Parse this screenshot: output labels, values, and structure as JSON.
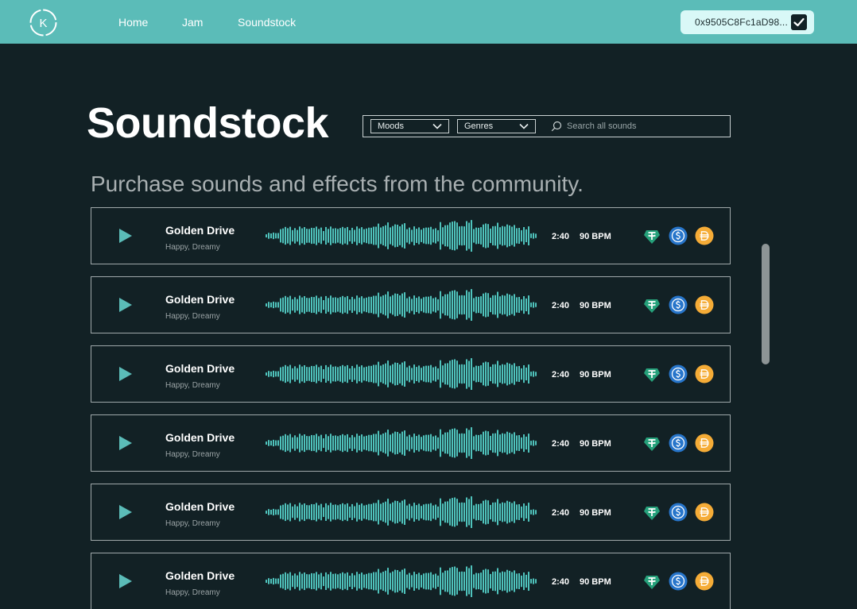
{
  "nav": {
    "logo_letter": "K",
    "links": [
      "Home",
      "Jam",
      "Soundstock"
    ],
    "wallet_address": "0x9505C8Fc1aD98..."
  },
  "header": {
    "title": "Soundstock",
    "filters": [
      {
        "label": "Moods"
      },
      {
        "label": "Genres"
      }
    ],
    "search_placeholder": "Search all sounds",
    "subtitle": "Purchase sounds and effects from the community."
  },
  "colors": {
    "accent": "#5bbcb8",
    "background": "#122125",
    "waveform": "#4fc3bc",
    "usdt": "#26a17b",
    "usdc": "#2775ca",
    "dai": "#f5ac37"
  },
  "tracks": [
    {
      "title": "Golden Drive",
      "tags": "Happy, Dreamy",
      "duration": "2:40",
      "bpm": "90 BPM",
      "coins": [
        "usdt-icon",
        "usdc-icon",
        "dai-icon"
      ]
    },
    {
      "title": "Golden Drive",
      "tags": "Happy, Dreamy",
      "duration": "2:40",
      "bpm": "90 BPM",
      "coins": [
        "usdt-icon",
        "usdc-icon",
        "dai-icon"
      ]
    },
    {
      "title": "Golden Drive",
      "tags": "Happy, Dreamy",
      "duration": "2:40",
      "bpm": "90 BPM",
      "coins": [
        "usdt-icon",
        "usdc-icon",
        "dai-icon"
      ]
    },
    {
      "title": "Golden Drive",
      "tags": "Happy, Dreamy",
      "duration": "2:40",
      "bpm": "90 BPM",
      "coins": [
        "usdt-icon",
        "usdc-icon",
        "dai-icon"
      ]
    },
    {
      "title": "Golden Drive",
      "tags": "Happy, Dreamy",
      "duration": "2:40",
      "bpm": "90 BPM",
      "coins": [
        "usdt-icon",
        "usdc-icon",
        "dai-icon"
      ]
    },
    {
      "title": "Golden Drive",
      "tags": "Happy, Dreamy",
      "duration": "2:40",
      "bpm": "90 BPM",
      "coins": [
        "usdt-icon",
        "usdc-icon",
        "dai-icon"
      ]
    }
  ]
}
